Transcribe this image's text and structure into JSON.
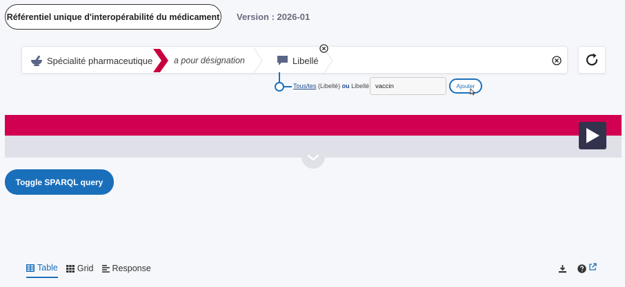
{
  "header": {
    "title": "Référentiel unique d'interopérabilité du médicament",
    "version": "Version : 2026-01"
  },
  "query_builder": {
    "criteria": [
      {
        "type": "class",
        "label": "Spécialité pharmaceutique",
        "icon": "mortar-pestle-icon"
      },
      {
        "type": "property",
        "label": "a pour désignation",
        "icon": "red-chevron-icon"
      },
      {
        "type": "literal",
        "label": "Libellé",
        "icon": "speech-bubble-icon"
      }
    ]
  },
  "filter": {
    "all_link": "Tous̲tes",
    "all_link_text": "Tous/tes",
    "type_note": "(Libellé)",
    "or_label": "ou",
    "field_label": "Libellé",
    "input_value": "vaccin",
    "add_label": "Ajouter"
  },
  "actions": {
    "sparql_toggle": "Toggle SPARQL query"
  },
  "results_tabs": [
    {
      "label": "Table",
      "icon": "table-icon",
      "active": true
    },
    {
      "label": "Grid",
      "icon": "grid-icon",
      "active": false
    },
    {
      "label": "Response",
      "icon": "response-icon",
      "active": false
    }
  ],
  "colors": {
    "accent_red": "#d20050",
    "accent_blue": "#1a6fbb",
    "dark_button": "#33334d",
    "grey_bar": "#dfe0e8"
  }
}
